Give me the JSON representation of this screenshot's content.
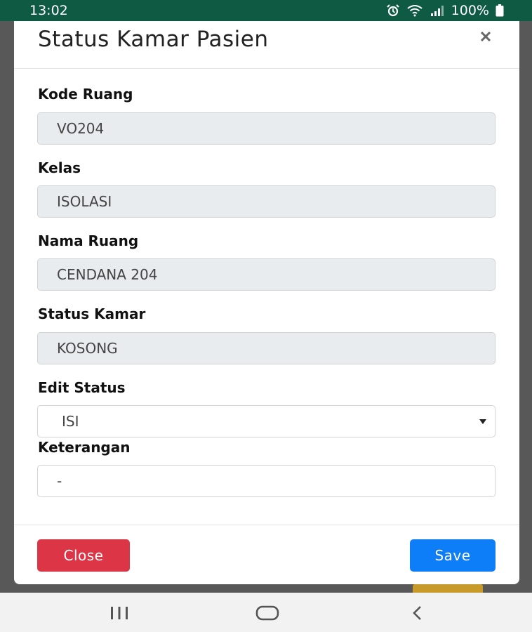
{
  "status_bar": {
    "time": "13:02",
    "battery_text": "100%",
    "icons": [
      "alarm-icon",
      "wifi-icon",
      "signal-icon",
      "battery-icon"
    ]
  },
  "modal": {
    "title": "Status Kamar Pasien",
    "close_icon": "close-icon",
    "fields": {
      "kode_ruang": {
        "label": "Kode Ruang",
        "value": "VO204"
      },
      "kelas": {
        "label": "Kelas",
        "value": "ISOLASI"
      },
      "nama_ruang": {
        "label": "Nama Ruang",
        "value": "CENDANA 204"
      },
      "status_kamar": {
        "label": "Status Kamar",
        "value": "KOSONG"
      },
      "edit_status": {
        "label": "Edit Status",
        "value": "ISI"
      },
      "keterangan": {
        "label": "Keterangan",
        "value": "-"
      }
    },
    "buttons": {
      "close_label": "Close",
      "save_label": "Save"
    }
  },
  "nav_bar": {
    "icons": [
      "recent-apps-icon",
      "home-icon",
      "back-icon"
    ]
  },
  "colors": {
    "status_bar": "#0f5a43",
    "close_button": "#dc3545",
    "save_button": "#0d7ef7",
    "readonly_field": "#e9ecef"
  }
}
